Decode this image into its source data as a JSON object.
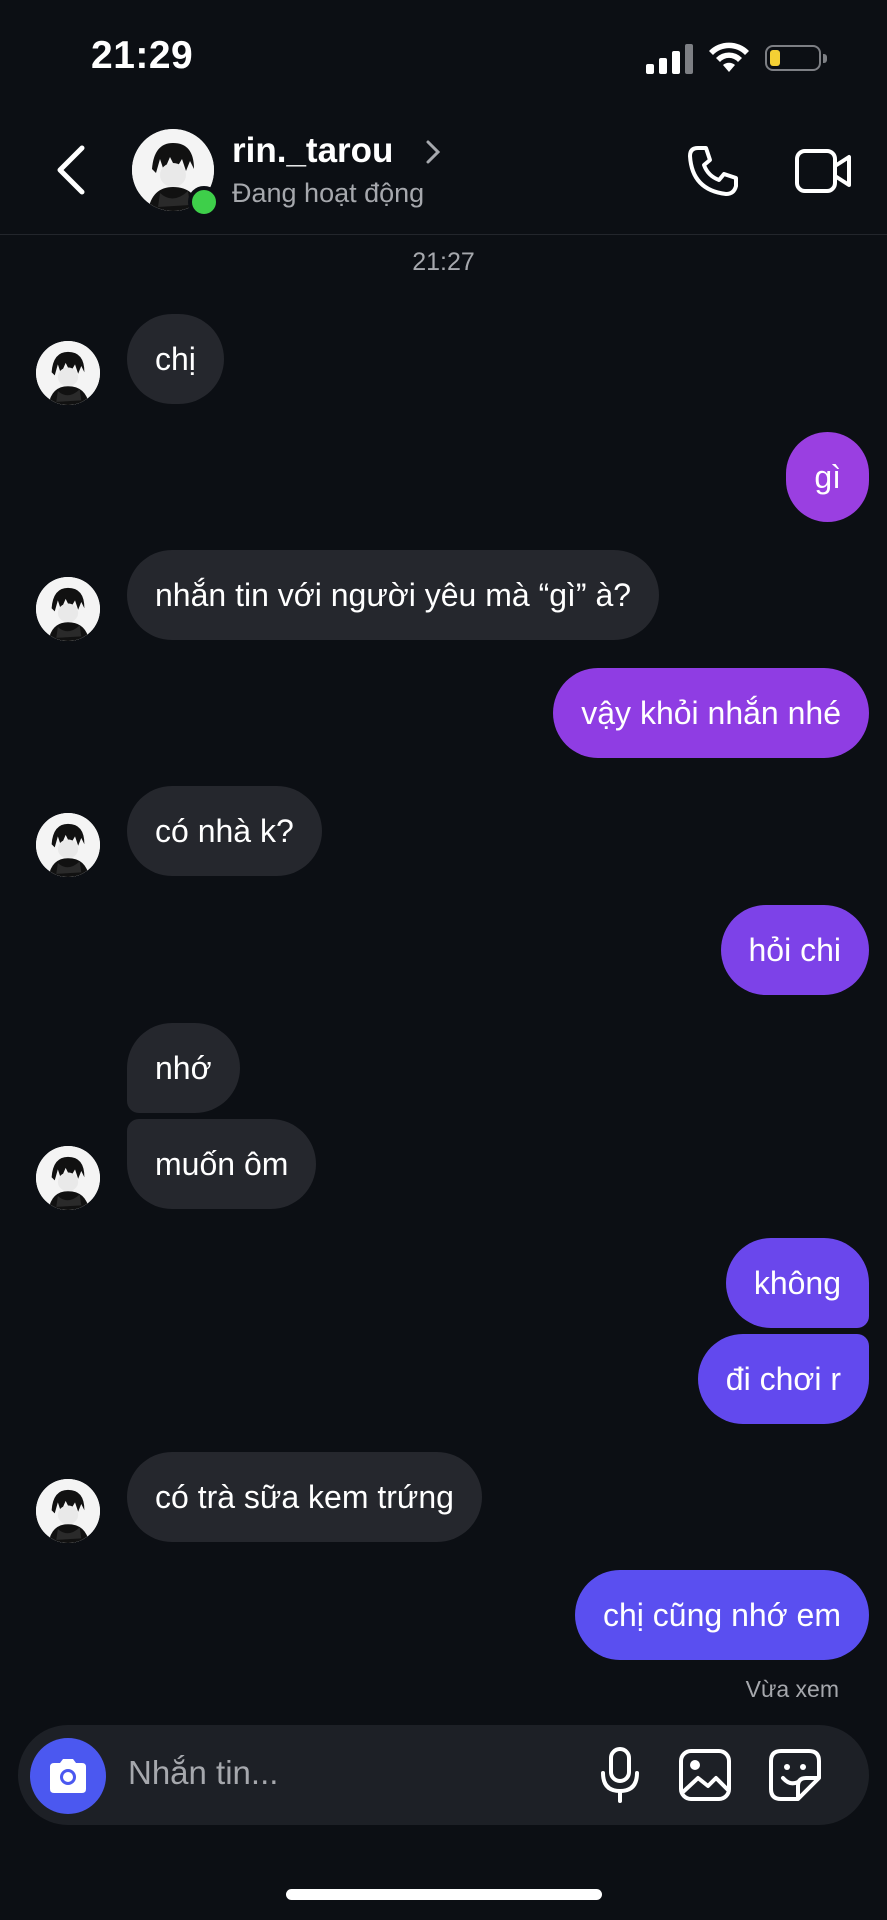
{
  "status_bar": {
    "time": "21:29",
    "battery_color": "#f4d034"
  },
  "header": {
    "name": "rin._tarou",
    "status": "Đang hoạt động",
    "icons": [
      "back-icon",
      "call-icon",
      "video-icon",
      "chevron-right-icon"
    ],
    "online_color": "#3ecf4a"
  },
  "chat": {
    "timestamp": "21:27",
    "messages": [
      {
        "from": "them",
        "text": "chị"
      },
      {
        "from": "me",
        "text": "gì"
      },
      {
        "from": "them",
        "text": "nhắn tin với người yêu mà “gì” à?"
      },
      {
        "from": "me",
        "text": "vậy khỏi nhắn nhé"
      },
      {
        "from": "them",
        "text": "có nhà k?"
      },
      {
        "from": "me",
        "text": "hỏi chi"
      },
      {
        "from": "them",
        "text": "nhớ"
      },
      {
        "from": "them",
        "text": "muốn ôm"
      },
      {
        "from": "me",
        "text": "không"
      },
      {
        "from": "me",
        "text": "đi chơi r"
      },
      {
        "from": "them",
        "text": "có trà sữa kem trứng"
      },
      {
        "from": "me",
        "text": "chị cũng nhớ em"
      }
    ],
    "seen_label": "Vừa xem",
    "colors": {
      "incoming": "#25272d",
      "outgoing_top": "#9b3ee0",
      "outgoing_bottom": "#5a4ff0"
    }
  },
  "composer": {
    "placeholder": "Nhắn tin...",
    "icons": [
      "camera-icon",
      "microphone-icon",
      "gallery-icon",
      "sticker-icon"
    ],
    "camera_color": "#4b58f0"
  }
}
